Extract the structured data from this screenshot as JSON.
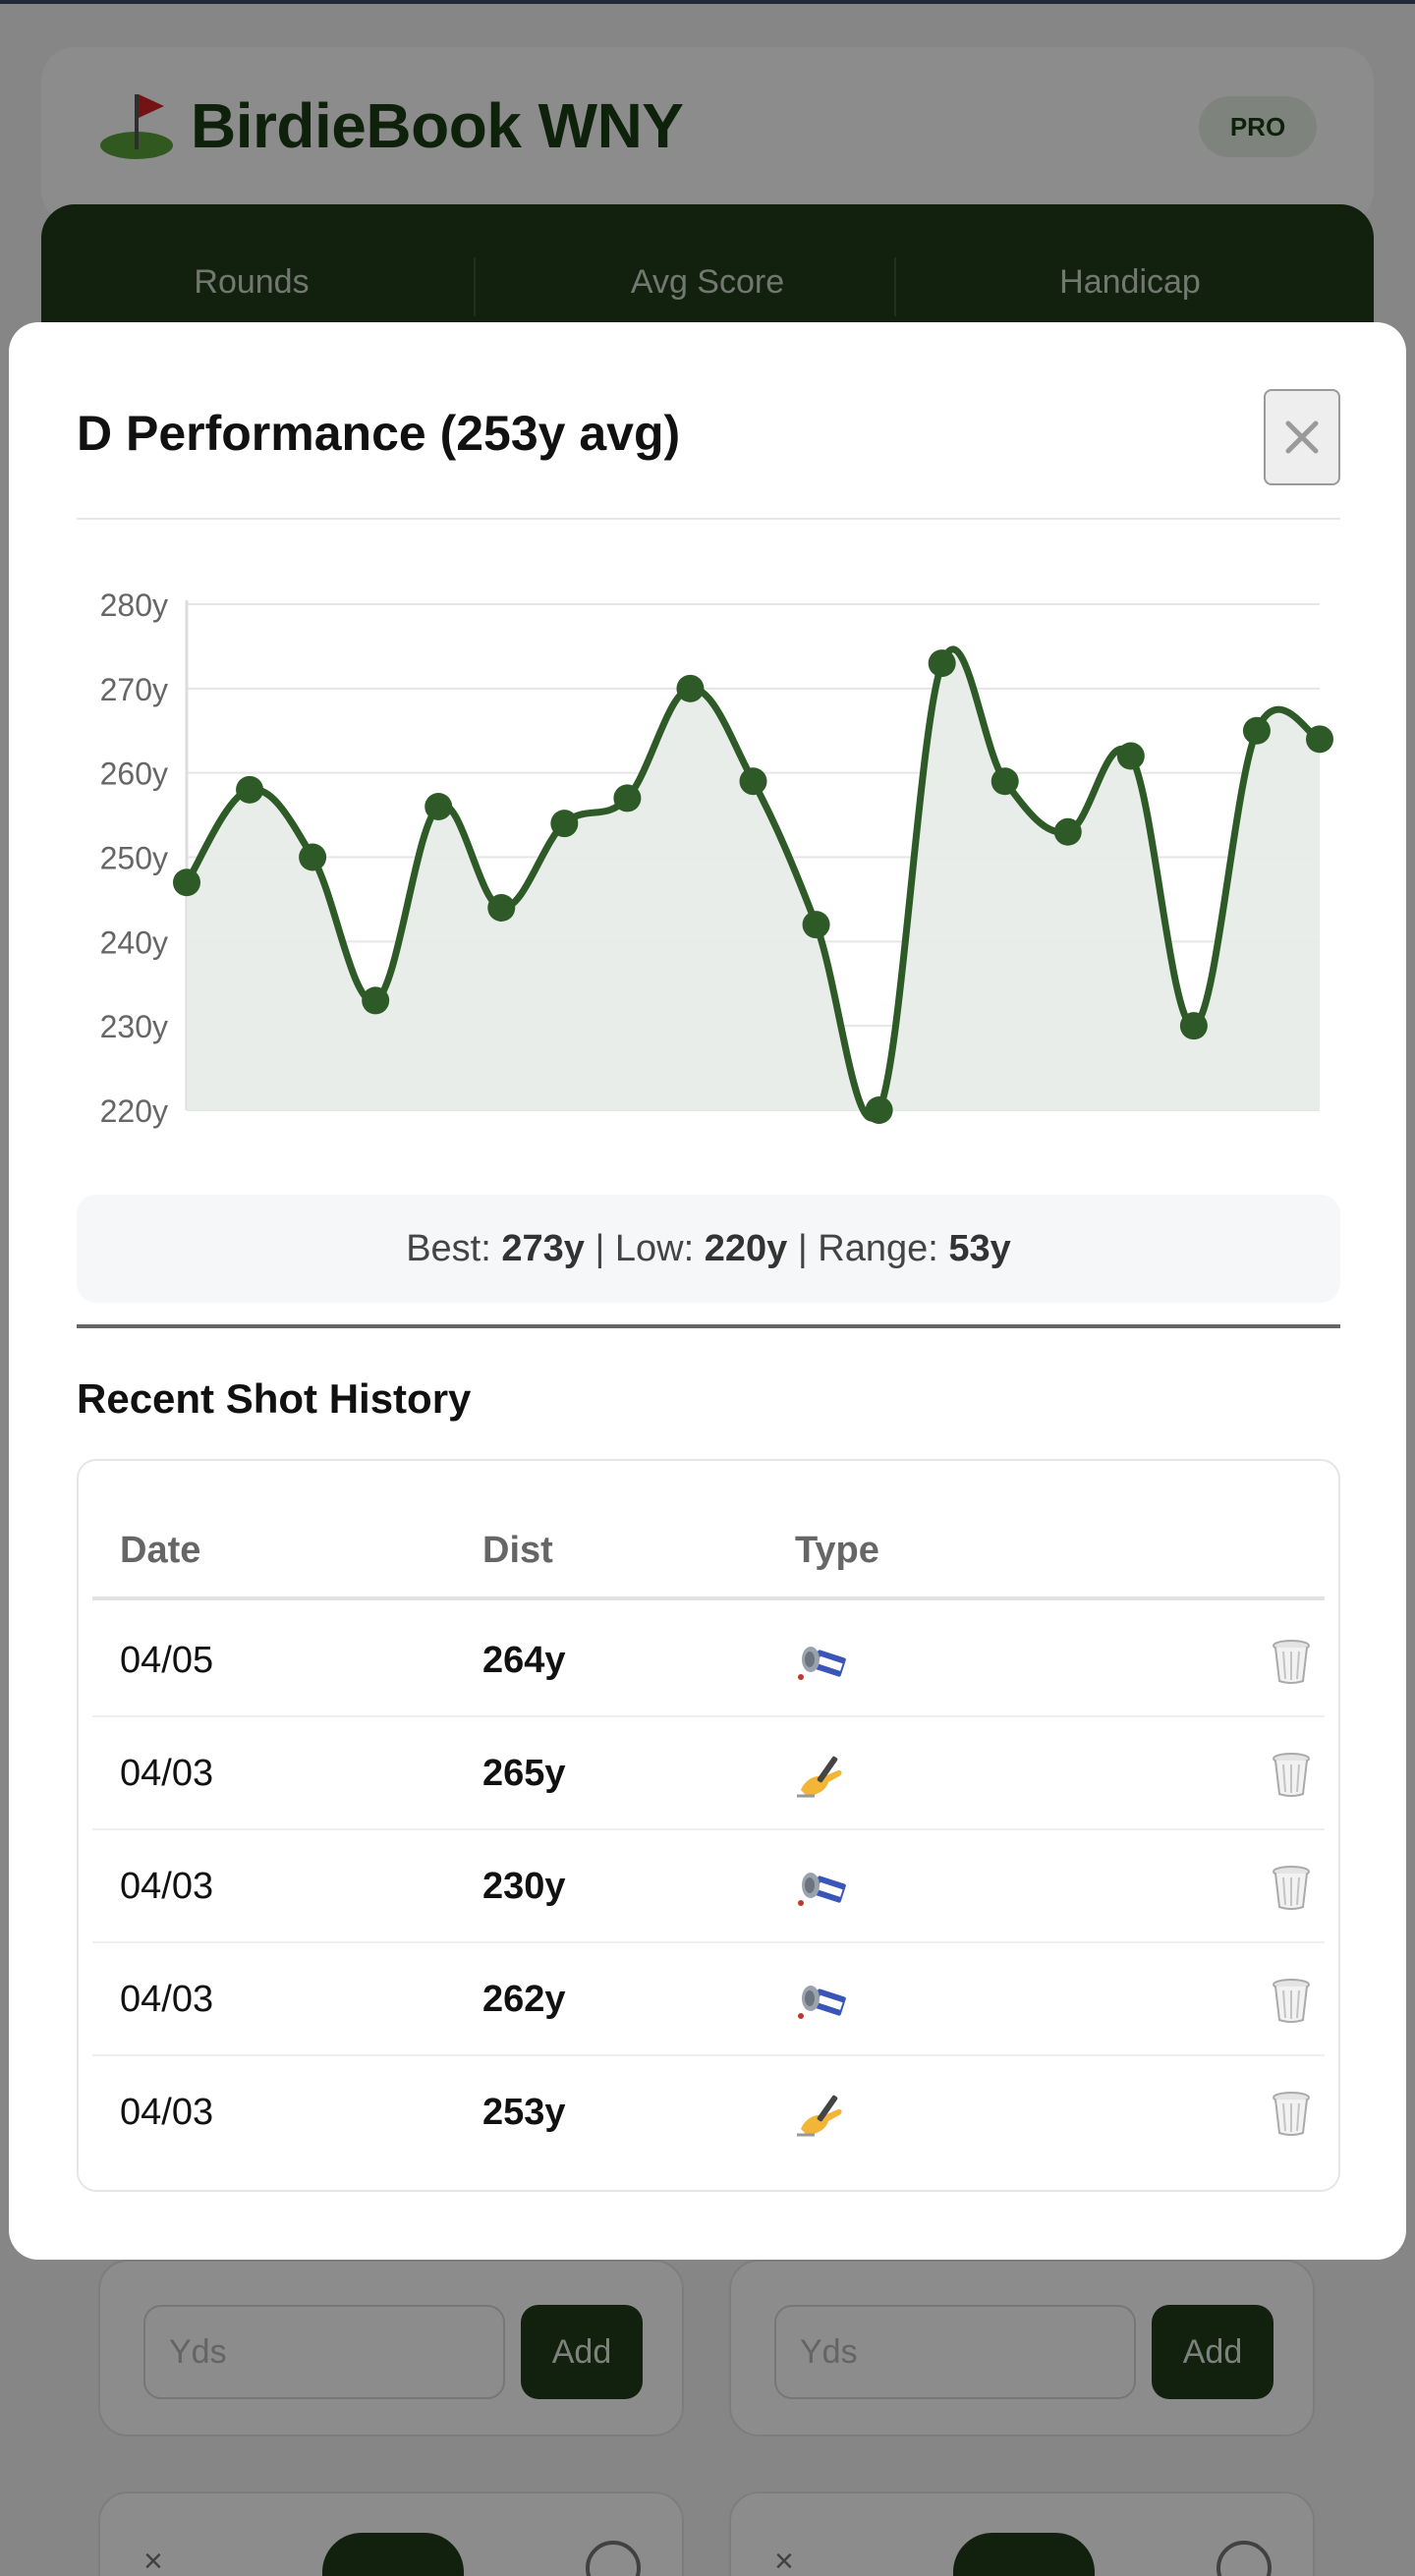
{
  "app": {
    "title": "BirdieBook WNY",
    "badge": "PRO"
  },
  "stats": {
    "labels": [
      "Rounds",
      "Avg Score",
      "Handicap"
    ]
  },
  "club_cards": {
    "yds_placeholder": "Yds",
    "add_label": "Add",
    "close_glyph": "×"
  },
  "modal": {
    "title": "D Performance (253y avg)",
    "close_glyph": "×",
    "summary": {
      "best_label": "Best:",
      "best_value": "273y",
      "low_label": "Low:",
      "low_value": "220y",
      "range_label": "Range:",
      "range_value": "53y",
      "separator": "|"
    },
    "history_title": "Recent Shot History",
    "columns": {
      "date": "Date",
      "dist": "Dist",
      "type": "Type"
    },
    "rows": [
      {
        "date": "04/05",
        "dist": "264y",
        "type": "satellite-icon"
      },
      {
        "date": "04/03",
        "dist": "265y",
        "type": "writing-hand-icon"
      },
      {
        "date": "04/03",
        "dist": "230y",
        "type": "satellite-icon"
      },
      {
        "date": "04/03",
        "dist": "262y",
        "type": "satellite-icon"
      },
      {
        "date": "04/03",
        "dist": "253y",
        "type": "writing-hand-icon"
      }
    ]
  },
  "chart_data": {
    "type": "line",
    "title": "",
    "xlabel": "",
    "ylabel": "",
    "ylim": [
      220,
      280
    ],
    "yticks": [
      "220y",
      "230y",
      "240y",
      "250y",
      "260y",
      "270y",
      "280y"
    ],
    "grid": true,
    "series": [
      {
        "values": [
          247,
          258,
          250,
          233,
          256,
          244,
          254,
          257,
          270,
          259,
          242,
          220,
          273,
          259,
          253,
          262,
          230,
          265,
          264
        ]
      }
    ],
    "colors": {
      "line": "#2d5a27",
      "fill": "#e8ece8",
      "grid": "#e6e6e6"
    }
  }
}
